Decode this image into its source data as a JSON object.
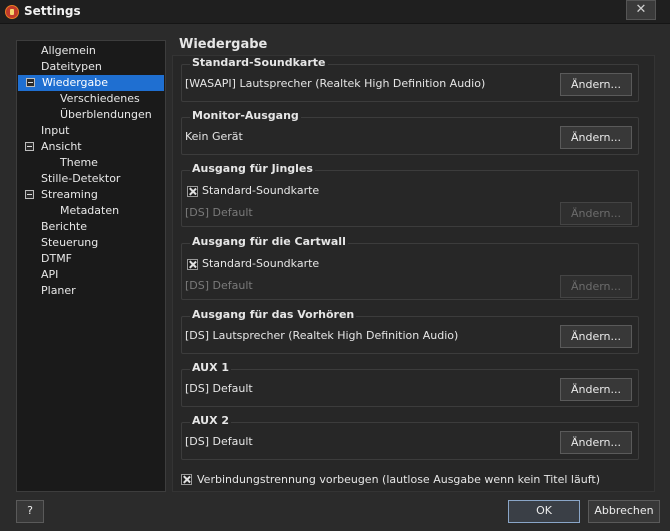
{
  "window": {
    "title": "Settings",
    "close_glyph": "✕"
  },
  "sidebar": {
    "items": [
      {
        "label": "Allgemein",
        "level": 0,
        "expander": false,
        "selected": false
      },
      {
        "label": "Dateitypen",
        "level": 0,
        "expander": false,
        "selected": false
      },
      {
        "label": "Wiedergabe",
        "level": 0,
        "expander": true,
        "selected": true
      },
      {
        "label": "Verschiedenes",
        "level": 1,
        "expander": false,
        "selected": false
      },
      {
        "label": "Überblendungen",
        "level": 1,
        "expander": false,
        "selected": false
      },
      {
        "label": "Input",
        "level": 0,
        "expander": false,
        "selected": false
      },
      {
        "label": "Ansicht",
        "level": 0,
        "expander": true,
        "selected": false
      },
      {
        "label": "Theme",
        "level": 1,
        "expander": false,
        "selected": false
      },
      {
        "label": "Stille-Detektor",
        "level": 0,
        "expander": false,
        "selected": false
      },
      {
        "label": "Streaming",
        "level": 0,
        "expander": true,
        "selected": false
      },
      {
        "label": "Metadaten",
        "level": 1,
        "expander": false,
        "selected": false
      },
      {
        "label": "Berichte",
        "level": 0,
        "expander": false,
        "selected": false
      },
      {
        "label": "Steuerung",
        "level": 0,
        "expander": false,
        "selected": false
      },
      {
        "label": "DTMF",
        "level": 0,
        "expander": false,
        "selected": false
      },
      {
        "label": "API",
        "level": 0,
        "expander": false,
        "selected": false
      },
      {
        "label": "Planer",
        "level": 0,
        "expander": false,
        "selected": false
      }
    ]
  },
  "main": {
    "title": "Wiedergabe",
    "groups": [
      {
        "label": "Standard-Soundkarte",
        "value": "[WASAPI] Lautsprecher (Realtek High Definition Audio)",
        "button": "Ändern...",
        "enabled": true
      },
      {
        "label": "Monitor-Ausgang",
        "value": "Kein Gerät",
        "button": "Ändern...",
        "enabled": true
      },
      {
        "label": "Ausgang für Jingles",
        "checkbox": "Standard-Soundkarte",
        "checked": true,
        "value": "[DS] Default",
        "button": "Ändern...",
        "enabled": false
      },
      {
        "label": "Ausgang für die Cartwall",
        "checkbox": "Standard-Soundkarte",
        "checked": true,
        "value": "[DS] Default",
        "button": "Ändern...",
        "enabled": false
      },
      {
        "label": "Ausgang für das Vorhören",
        "value": "[DS] Lautsprecher (Realtek High Definition Audio)",
        "button": "Ändern...",
        "enabled": true
      },
      {
        "label": "AUX 1",
        "value": "[DS] Default",
        "button": "Ändern...",
        "enabled": true
      },
      {
        "label": "AUX 2",
        "value": "[DS] Default",
        "button": "Ändern...",
        "enabled": true
      }
    ],
    "prevent_disconnect": {
      "label": "Verbindungstrennung vorbeugen (lautlose Ausgabe wenn kein Titel läuft)",
      "checked": true
    }
  },
  "footer": {
    "help_label": "?",
    "ok_label": "OK",
    "cancel_label": "Abbrechen"
  }
}
